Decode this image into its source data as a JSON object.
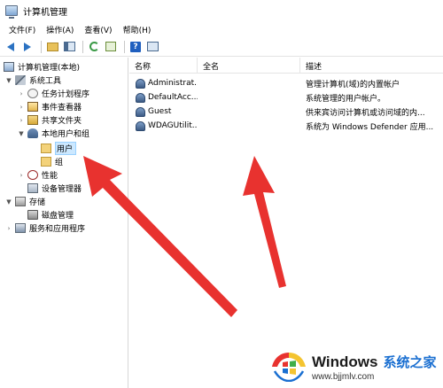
{
  "window": {
    "title": "计算机管理"
  },
  "menu": [
    "文件(F)",
    "操作(A)",
    "查看(V)",
    "帮助(H)"
  ],
  "toolbar": {
    "back": "back-arrow-icon",
    "forward": "forward-arrow-icon",
    "help_glyph": "?"
  },
  "tree": {
    "root": "计算机管理(本地)",
    "system_tools": "系统工具",
    "task_scheduler": "任务计划程序",
    "event_viewer": "事件查看器",
    "shared_folders": "共享文件夹",
    "local_users_groups": "本地用户和组",
    "users": "用户",
    "groups": "组",
    "performance": "性能",
    "device_manager": "设备管理器",
    "storage": "存储",
    "disk_management": "磁盘管理",
    "services_apps": "服务和应用程序"
  },
  "columns": {
    "name": "名称",
    "full_name": "全名",
    "description": "描述"
  },
  "users": [
    {
      "name": "Administrat...",
      "full_name": "",
      "description": "管理计算机(域)的内置帐户"
    },
    {
      "name": "DefaultAcc...",
      "full_name": "",
      "description": "系统管理的用户帐户。"
    },
    {
      "name": "Guest",
      "full_name": "",
      "description": "供来宾访问计算机或访问域的内..."
    },
    {
      "name": "WDAGUtilit...",
      "full_name": "",
      "description": "系统为 Windows Defender 应用..."
    }
  ],
  "watermark": {
    "brand": "Windows",
    "cn": "系统之家",
    "url": "www.bjjmlv.com"
  },
  "colors": {
    "arrow": "#e8322f",
    "selection": "#cce8ff",
    "accent": "#2b72c2"
  }
}
